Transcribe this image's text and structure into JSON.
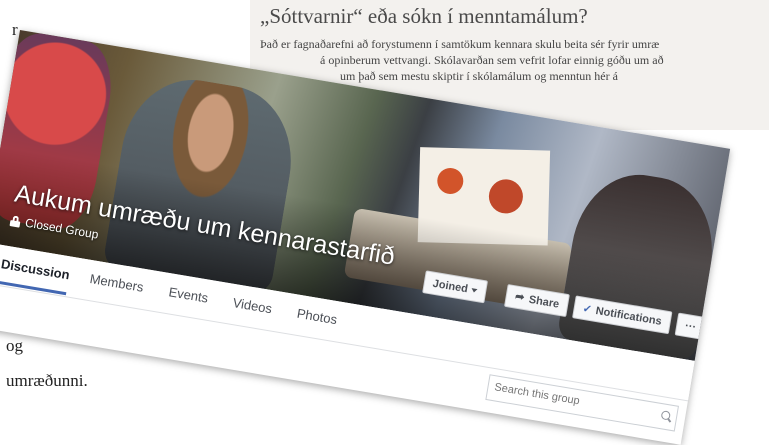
{
  "background": {
    "left_fragments": [
      "r",
      "."
    ],
    "top_article": {
      "headline": "„Sóttvarnir“ eða sókn í menntamálum?",
      "lines": [
        "Það er fagnaðarefni að forystumenn í samtökum kennara skulu beita sér fyrir umræ",
        "á opinberum vettvangi. Skólavarðan sem vefrit lofar einnig góðu um að",
        "um það sem mestu skiptir í skólamálum og menntun hér á"
      ]
    },
    "bottom_fragments": [
      "og",
      "umræðunni."
    ]
  },
  "group": {
    "name": "Aukum umræðu um kennarastarfið",
    "privacy": "Closed Group"
  },
  "tabs": [
    {
      "label": "Discussion",
      "active": true
    },
    {
      "label": "Members",
      "active": false
    },
    {
      "label": "Events",
      "active": false
    },
    {
      "label": "Videos",
      "active": false
    },
    {
      "label": "Photos",
      "active": false
    }
  ],
  "actions": {
    "joined_label": "Joined",
    "share_label": "Share",
    "notifications_label": "Notifications",
    "more_label": "···"
  },
  "search": {
    "placeholder": "Search this group"
  },
  "colors": {
    "accent": "#4267b2",
    "tab_border": "#dddfe2"
  }
}
